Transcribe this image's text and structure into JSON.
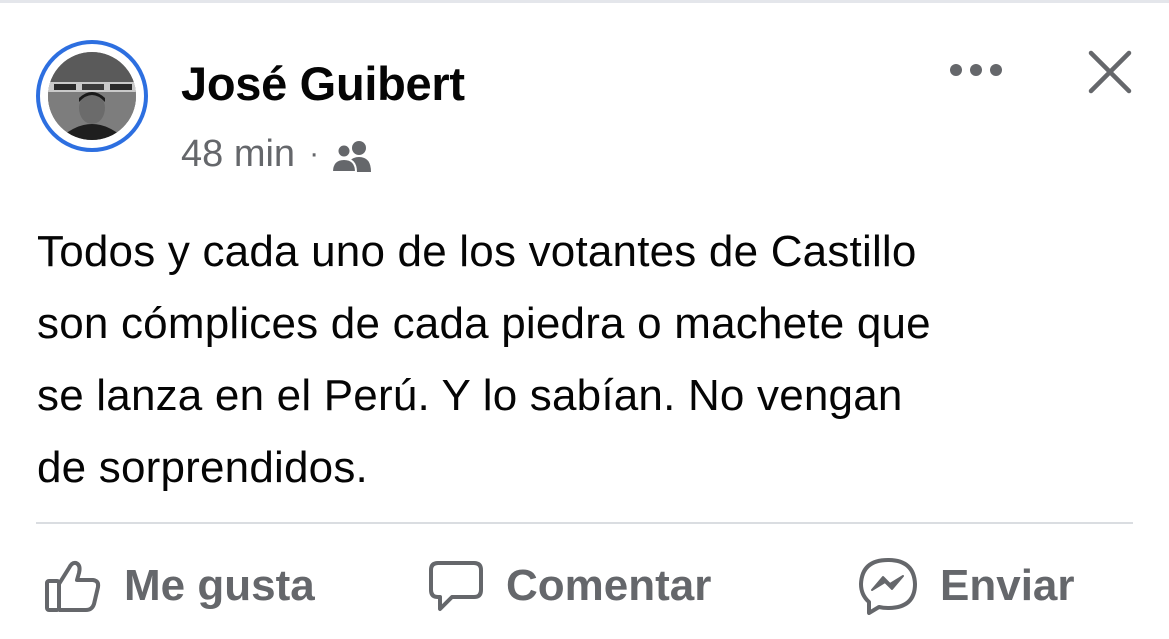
{
  "post": {
    "author_name": "José Guibert",
    "timestamp": "48 min",
    "separator": "·",
    "audience_icon": "friends-icon",
    "text_lines": [
      "Todos y cada uno de los votantes de Castillo",
      "son cómplices de cada piedra o machete que",
      "se lanza en el Perú. Y lo sabían. No vengan",
      "de sorprendidos."
    ]
  },
  "header": {
    "more_icon": "more-options-icon",
    "close_icon": "close-icon"
  },
  "actions": {
    "like_label": "Me gusta",
    "comment_label": "Comentar",
    "send_label": "Enviar"
  },
  "colors": {
    "accent": "#2d6fe0",
    "secondary_text": "#65676b",
    "primary_text": "#050505",
    "divider": "#dadde1"
  }
}
